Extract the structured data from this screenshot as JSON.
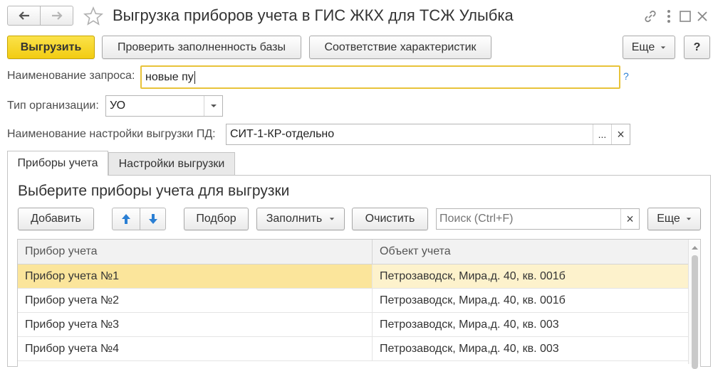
{
  "window": {
    "title": "Выгрузка приборов учета в ГИС ЖКХ для ТСЖ Улыбка",
    "back_icon": "arrow-left-icon",
    "forward_icon": "arrow-right-icon",
    "favorite_icon": "star-icon",
    "link_icon": "link-icon",
    "menu_icon": "more-vertical-icon",
    "maximize_icon": "maximize-icon",
    "close_icon": "close-icon"
  },
  "toolbar": {
    "export_label": "Выгрузить",
    "check_label": "Проверить заполненность базы",
    "mapping_label": "Соответствие характеристик",
    "more_label": "Еще",
    "help_label": "?"
  },
  "form": {
    "request_name_label": "Наименование запроса:",
    "request_name_value": "новые пу",
    "request_help": "?",
    "org_type_label": "Тип организации:",
    "org_type_value": "УО",
    "export_setting_label": "Наименование настройки выгрузки ПД:",
    "export_setting_value": "СИТ-1-КР-отдельно",
    "select_button": "...",
    "clear_button": "×"
  },
  "tabs": [
    {
      "label": "Приборы учета",
      "active": true
    },
    {
      "label": "Настройки выгрузки",
      "active": false
    }
  ],
  "panel": {
    "heading": "Выберите приборы учета для выгрузки",
    "add_label": "Добавить",
    "pick_label": "Подбор",
    "fill_label": "Заполнить",
    "clear_label": "Очистить",
    "search_placeholder": "Поиск (Ctrl+F)",
    "search_clear": "×",
    "more_label": "Еще"
  },
  "table": {
    "columns": [
      "Прибор учета",
      "Объект учета"
    ],
    "rows": [
      {
        "device": "Прибор учета №1",
        "object": "Петрозаводск, Мира,д. 40, кв. 001б",
        "selected": true
      },
      {
        "device": "Прибор учета №2",
        "object": "Петрозаводск, Мира,д. 40, кв. 001б",
        "selected": false
      },
      {
        "device": "Прибор учета №3",
        "object": "Петрозаводск, Мира,д. 40, кв. 003",
        "selected": false
      },
      {
        "device": "Прибор учета №4",
        "object": "Петрозаводск, Мира,д. 40, кв. 003",
        "selected": false
      }
    ]
  },
  "colors": {
    "accent_yellow": "#f5d21c",
    "selected_row": "#fbe59b",
    "selected_row_cell2": "#fdf2cc",
    "focus_border": "#e8c33a",
    "arrow_blue": "#2a7fd4"
  }
}
